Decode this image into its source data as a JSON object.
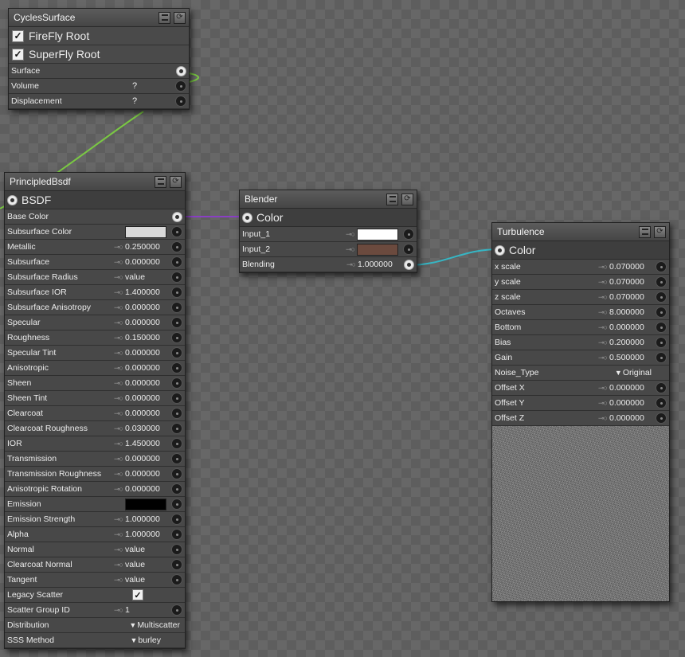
{
  "icons": {
    "menu": "menu-icon",
    "reload": "reload-icon",
    "socket_in": "input-socket-icon",
    "socket_out": "output-socket-icon",
    "key": "key-icon"
  },
  "colors": {
    "wire_surface": "#7ac943",
    "wire_color": "#8a3fc4",
    "wire_turbulence": "#36b6c4",
    "subsurface_color": "#d9d9d9",
    "emission": "#000000",
    "input_1": "#ffffff",
    "input_2": "#6b4a3e"
  },
  "cycles": {
    "title": "CyclesSurface",
    "checks": [
      {
        "label": "FireFly Root",
        "checked": "✓"
      },
      {
        "label": "SuperFly Root",
        "checked": "✓"
      }
    ],
    "rows": [
      {
        "label": "Surface"
      },
      {
        "label": "Volume",
        "value": "?"
      },
      {
        "label": "Displacement",
        "value": "?"
      }
    ]
  },
  "principled": {
    "title": "PrincipledBsdf",
    "output": "BSDF",
    "rows": [
      {
        "label": "Base Color"
      },
      {
        "label": "Subsurface Color"
      },
      {
        "label": "Metallic",
        "value": "0.250000"
      },
      {
        "label": "Subsurface",
        "value": "0.000000"
      },
      {
        "label": "Subsurface Radius",
        "value": "value"
      },
      {
        "label": "Subsurface IOR",
        "value": "1.400000"
      },
      {
        "label": "Subsurface Anisotropy",
        "value": "0.000000"
      },
      {
        "label": "Specular",
        "value": "0.000000"
      },
      {
        "label": "Roughness",
        "value": "0.150000"
      },
      {
        "label": "Specular Tint",
        "value": "0.000000"
      },
      {
        "label": "Anisotropic",
        "value": "0.000000"
      },
      {
        "label": "Sheen",
        "value": "0.000000"
      },
      {
        "label": "Sheen Tint",
        "value": "0.000000"
      },
      {
        "label": "Clearcoat",
        "value": "0.000000"
      },
      {
        "label": "Clearcoat Roughness",
        "value": "0.030000"
      },
      {
        "label": "IOR",
        "value": "1.450000"
      },
      {
        "label": "Transmission",
        "value": "0.000000"
      },
      {
        "label": "Transmission Roughness",
        "value": "0.000000"
      },
      {
        "label": "Anisotropic Rotation",
        "value": "0.000000"
      },
      {
        "label": "Emission"
      },
      {
        "label": "Emission Strength",
        "value": "1.000000"
      },
      {
        "label": "Alpha",
        "value": "1.000000"
      },
      {
        "label": "Normal",
        "value": "value"
      },
      {
        "label": "Clearcoat Normal",
        "value": "value"
      },
      {
        "label": "Tangent",
        "value": "value"
      },
      {
        "label": "Legacy Scatter",
        "checked": "✓"
      },
      {
        "label": "Scatter Group ID",
        "value": "1"
      },
      {
        "label": "Distribution",
        "value": "Multiscatter"
      },
      {
        "label": "SSS Method",
        "value": "burley"
      }
    ]
  },
  "blender": {
    "title": "Blender",
    "output": "Color",
    "rows": [
      {
        "label": "Input_1"
      },
      {
        "label": "Input_2"
      },
      {
        "label": "Blending",
        "value": "1.000000"
      }
    ]
  },
  "turbulence": {
    "title": "Turbulence",
    "output": "Color",
    "rows": [
      {
        "label": "x scale",
        "value": "0.070000"
      },
      {
        "label": "y scale",
        "value": "0.070000"
      },
      {
        "label": "z scale",
        "value": "0.070000"
      },
      {
        "label": "Octaves",
        "value": "8.000000"
      },
      {
        "label": "Bottom",
        "value": "0.000000"
      },
      {
        "label": "Bias",
        "value": "0.200000"
      },
      {
        "label": "Gain",
        "value": "0.500000"
      },
      {
        "label": "Noise_Type",
        "value": "Original"
      },
      {
        "label": "Offset X",
        "value": "0.000000"
      },
      {
        "label": "Offset Y",
        "value": "0.000000"
      },
      {
        "label": "Offset Z",
        "value": "0.000000"
      }
    ]
  }
}
